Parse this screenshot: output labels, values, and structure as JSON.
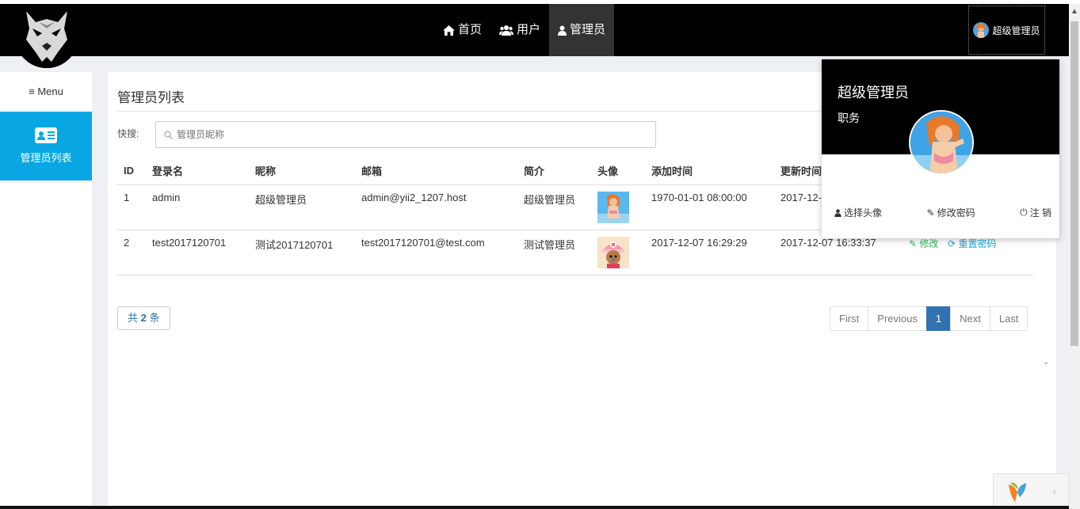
{
  "nav": {
    "items": [
      {
        "label": "首页",
        "icon": "home-icon"
      },
      {
        "label": "用户",
        "icon": "users-icon"
      },
      {
        "label": "管理员",
        "icon": "user-icon",
        "active": true
      }
    ],
    "user_label": "超级管理员"
  },
  "sidebar": {
    "menu_label": "Menu",
    "items": [
      {
        "label": "管理员列表",
        "icon": "id-card-icon",
        "active": true
      }
    ]
  },
  "main": {
    "title": "管理员列表",
    "search_label": "快搜:",
    "search_placeholder": "管理员昵称",
    "columns": [
      "ID",
      "登录名",
      "昵称",
      "邮箱",
      "简介",
      "头像",
      "添加时间",
      "更新时间"
    ],
    "rows": [
      {
        "id": "1",
        "login": "admin",
        "nick": "超级管理员",
        "email": "admin@yii2_1207.host",
        "intro": "超级管理员",
        "avatar": "nami-avatar",
        "added": "1970-01-01 08:00:00",
        "updated": "2017-12-"
      },
      {
        "id": "2",
        "login": "test2017120701",
        "nick": "测试2017120701",
        "email": "test2017120701@test.com",
        "intro": "测试管理员",
        "avatar": "chopper-avatar",
        "added": "2017-12-07 16:29:29",
        "updated": "2017-12-07 16:33:37",
        "edit_label": "修改",
        "reset_label": "重置密码"
      }
    ],
    "count_prefix": "共",
    "count": "2",
    "count_suffix": "条",
    "pager": {
      "first": "First",
      "previous": "Previous",
      "current": "1",
      "next": "Next",
      "last": "Last"
    }
  },
  "dropdown": {
    "name": "超级管理员",
    "role": "职务",
    "choose_avatar": "选择头像",
    "change_password": "修改密码",
    "logout": "注 销"
  },
  "colors": {
    "accent": "#08a7e4",
    "pager_active": "#3173b0",
    "edit": "#2db85c"
  }
}
